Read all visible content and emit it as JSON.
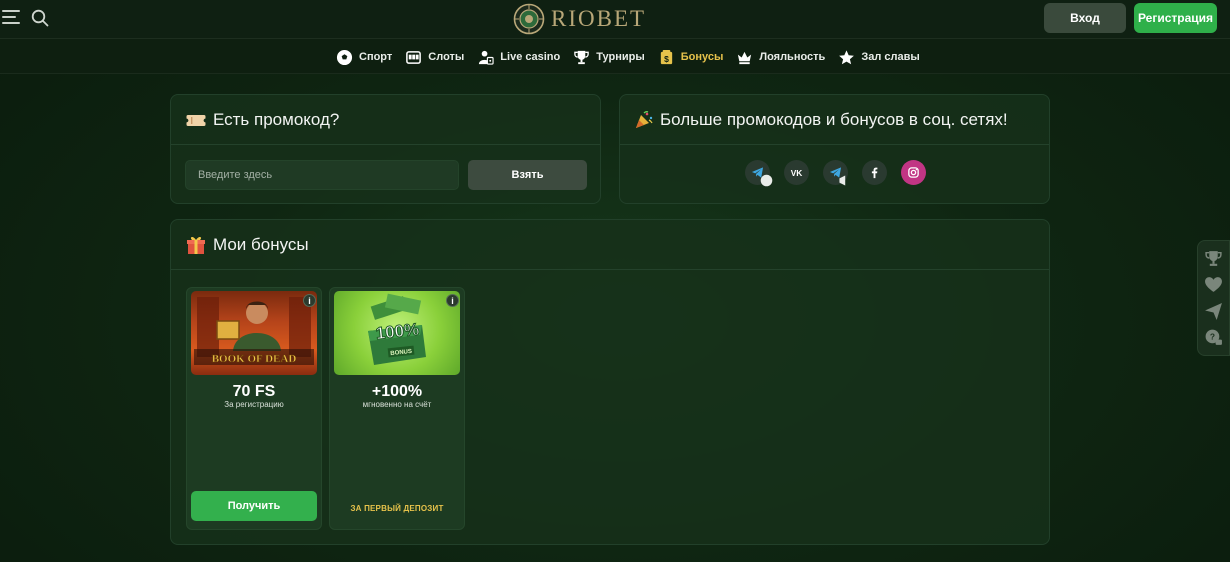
{
  "header": {
    "logo_text": "RIOBET",
    "login_label": "Вход",
    "register_label": "Регистрация"
  },
  "nav": {
    "items": [
      {
        "label": "Спорт",
        "icon": "soccer-ball-icon"
      },
      {
        "label": "Слоты",
        "icon": "slot-machine-icon"
      },
      {
        "label": "Live casino",
        "icon": "live-dealer-icon"
      },
      {
        "label": "Турниры",
        "icon": "trophy-icon"
      },
      {
        "label": "Бонусы",
        "icon": "bonus-icon",
        "active": true
      },
      {
        "label": "Лояльность",
        "icon": "crown-icon"
      },
      {
        "label": "Зал славы",
        "icon": "star-icon"
      }
    ],
    "active_color": "#e6c24b"
  },
  "promo": {
    "title": "Есть промокод?",
    "input_placeholder": "Введите здесь",
    "input_value": "",
    "submit_label": "Взять"
  },
  "social": {
    "title": "Больше промокодов и бонусов в соц. сетях!",
    "links": [
      {
        "name": "telegram-chat",
        "color": "#2a3a30"
      },
      {
        "name": "vk",
        "color": "#2a3a30"
      },
      {
        "name": "telegram-channel",
        "color": "#2a3a30"
      },
      {
        "name": "facebook",
        "color": "#2a3a30"
      },
      {
        "name": "instagram",
        "color": "#c13584"
      }
    ]
  },
  "my_bonuses": {
    "title": "Мои бонусы",
    "cards": [
      {
        "game_art_text": "BOOK OF DEAD",
        "title": "70 FS",
        "subtitle": "За регистрацию",
        "button_label": "Получить"
      },
      {
        "promo_art_text": "100%",
        "promo_art_sub": "BONUS",
        "title": "+100%",
        "subtitle": "мгновенно на счёт",
        "footer": "ЗА ПЕРВЫЙ ДЕПОЗИТ"
      }
    ]
  },
  "side_widget": {
    "icons": [
      "trophy-icon",
      "heart-icon",
      "send-icon",
      "support-chat-icon"
    ]
  },
  "colors": {
    "accent_green": "#2fb04a",
    "gold": "#e6c24b",
    "background": "#0f2612"
  }
}
